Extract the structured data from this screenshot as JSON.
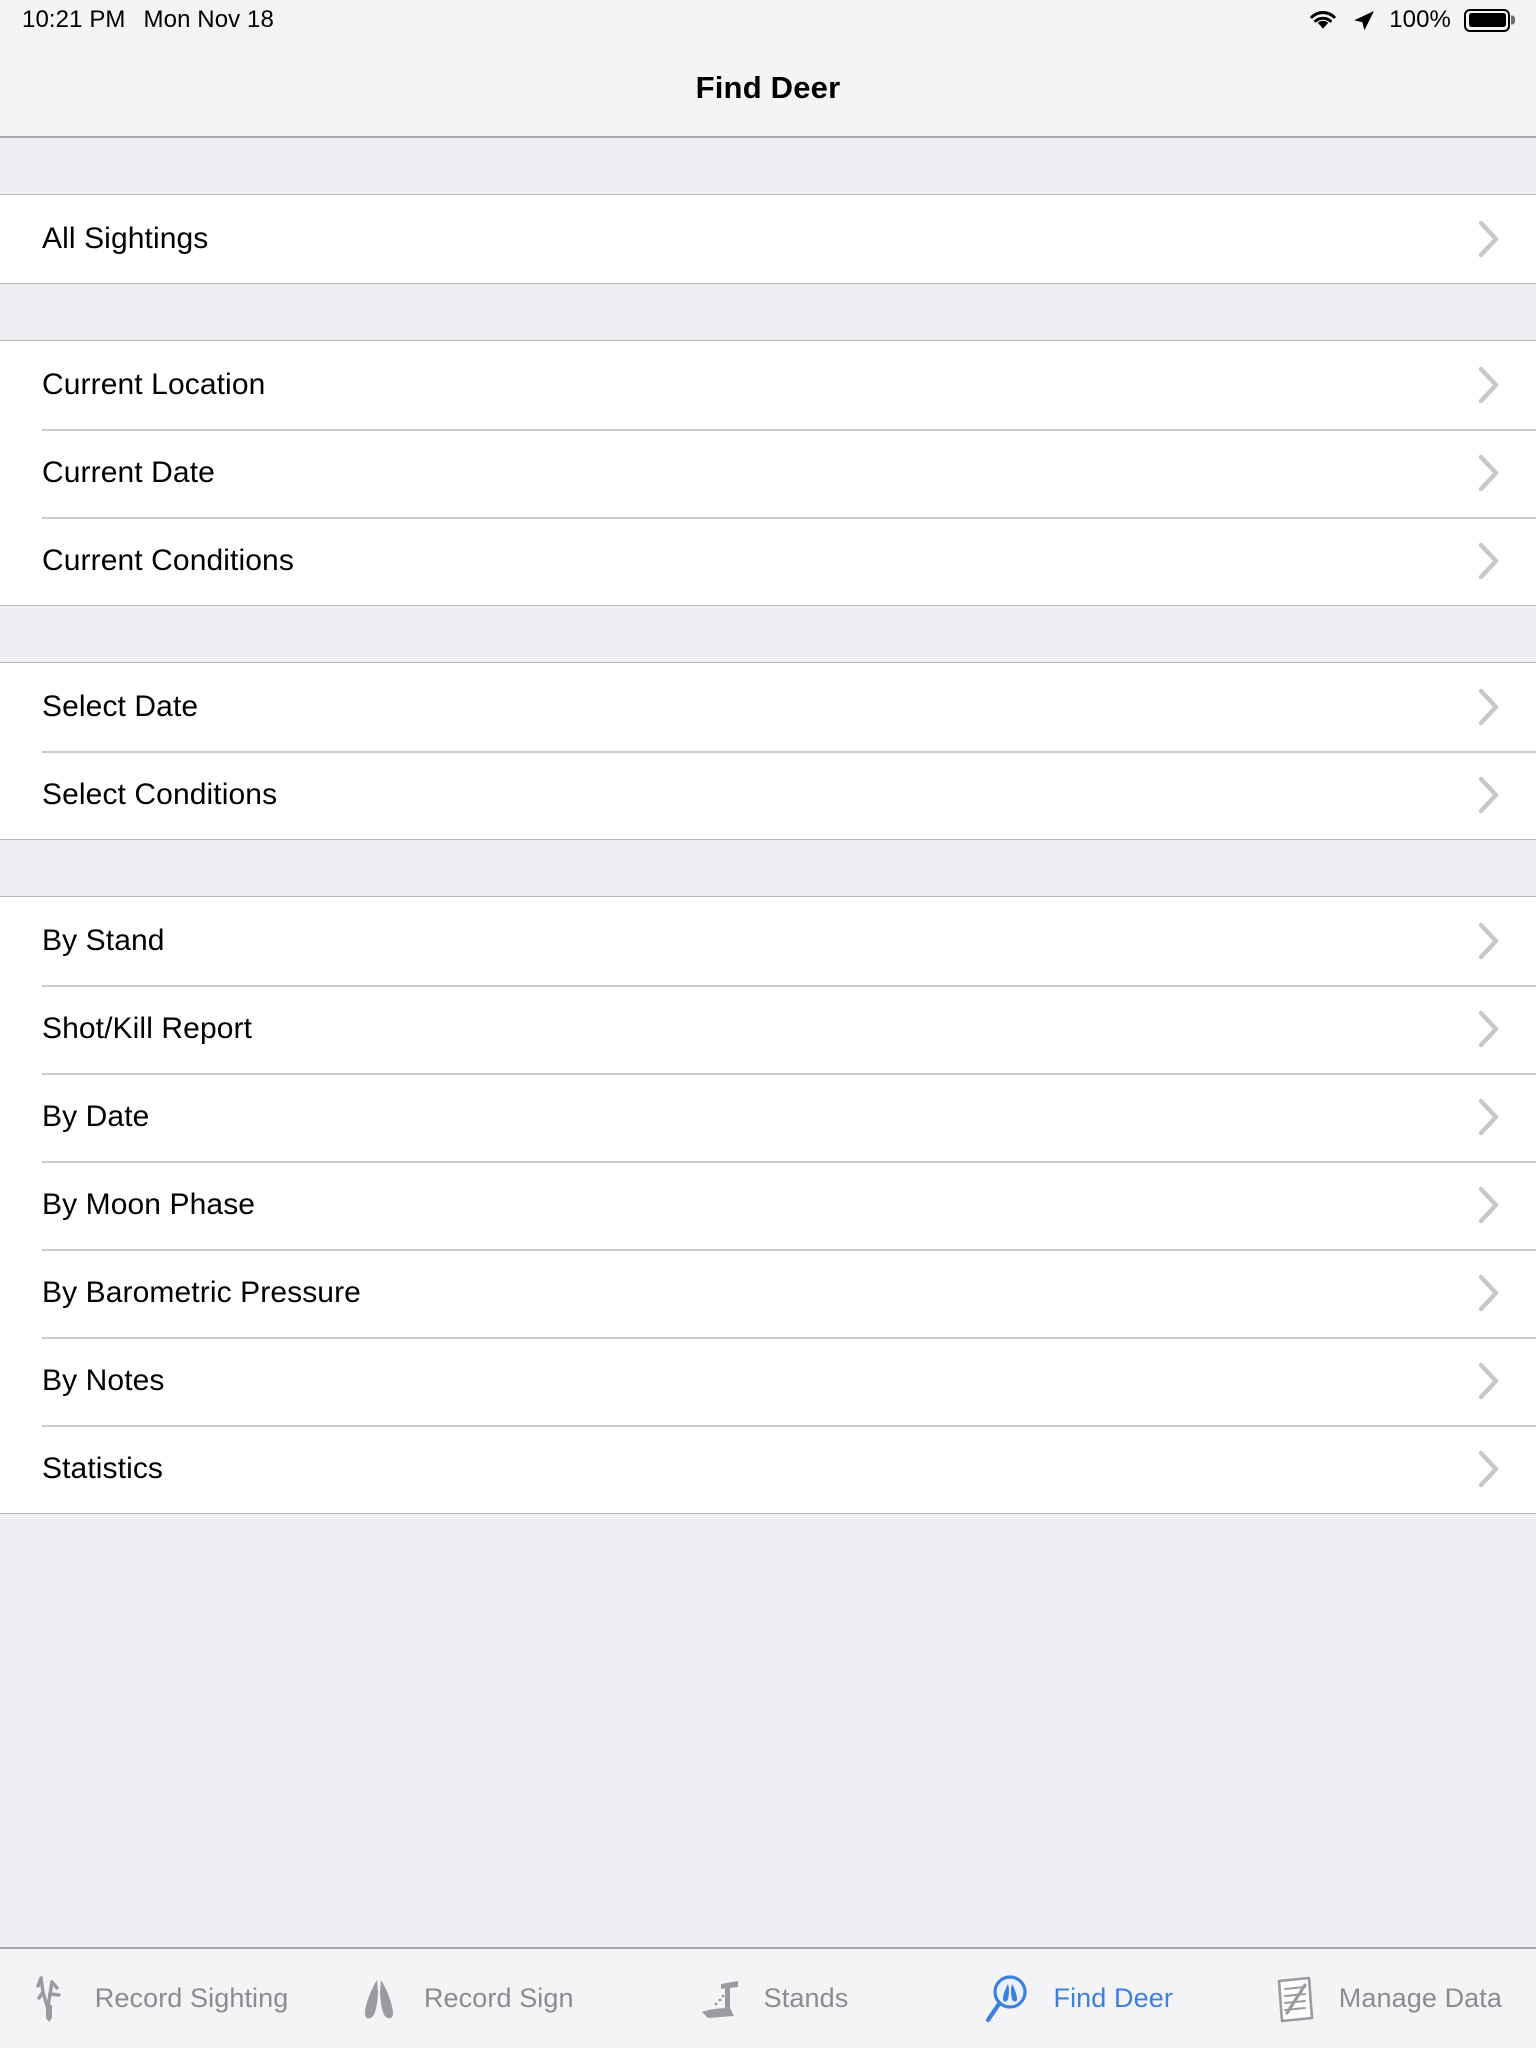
{
  "statusbar": {
    "time": "10:21 PM",
    "date": "Mon Nov 18",
    "battery_percent": "100%",
    "wifi_icon": "wifi-icon",
    "location_icon": "location-arrow-icon",
    "battery_icon": "battery-full-icon"
  },
  "navbar": {
    "title": "Find Deer"
  },
  "colors": {
    "accent_blue": "#3b7fe0",
    "grouped_background": "#eeeef3",
    "cell_background": "#ffffff",
    "bar_background": "#f4f4f6",
    "separator": "#c9c9ce",
    "chevron": "#c7c7cc",
    "inactive_tab": "#8b8b90"
  },
  "sections": [
    {
      "id": "all-sightings",
      "rows": [
        {
          "label": "All Sightings",
          "accessory": "chevron-right-icon"
        }
      ]
    },
    {
      "id": "current",
      "rows": [
        {
          "label": "Current Location",
          "accessory": "chevron-right-icon"
        },
        {
          "label": "Current Date",
          "accessory": "chevron-right-icon"
        },
        {
          "label": "Current Conditions",
          "accessory": "chevron-right-icon"
        }
      ]
    },
    {
      "id": "select",
      "rows": [
        {
          "label": "Select Date",
          "accessory": "chevron-right-icon"
        },
        {
          "label": "Select Conditions",
          "accessory": "chevron-right-icon"
        }
      ]
    },
    {
      "id": "reports",
      "rows": [
        {
          "label": "By Stand",
          "accessory": "chevron-right-icon"
        },
        {
          "label": "Shot/Kill Report",
          "accessory": "chevron-right-icon"
        },
        {
          "label": "By Date",
          "accessory": "chevron-right-icon"
        },
        {
          "label": "By Moon Phase",
          "accessory": "chevron-right-icon"
        },
        {
          "label": "By Barometric Pressure",
          "accessory": "chevron-right-icon"
        },
        {
          "label": "By Notes",
          "accessory": "chevron-right-icon"
        },
        {
          "label": "Statistics",
          "accessory": "chevron-right-icon"
        }
      ]
    }
  ],
  "tabbar": {
    "tabs": [
      {
        "label": "Record Sighting",
        "icon": "deer-antler-icon",
        "active": false
      },
      {
        "label": "Record Sign",
        "icon": "deer-track-icon",
        "active": false
      },
      {
        "label": "Stands",
        "icon": "tree-stand-icon",
        "active": false
      },
      {
        "label": "Find Deer",
        "icon": "magnifier-deer-track-icon",
        "active": true
      },
      {
        "label": "Manage Data",
        "icon": "document-pencil-icon",
        "active": false
      }
    ]
  }
}
